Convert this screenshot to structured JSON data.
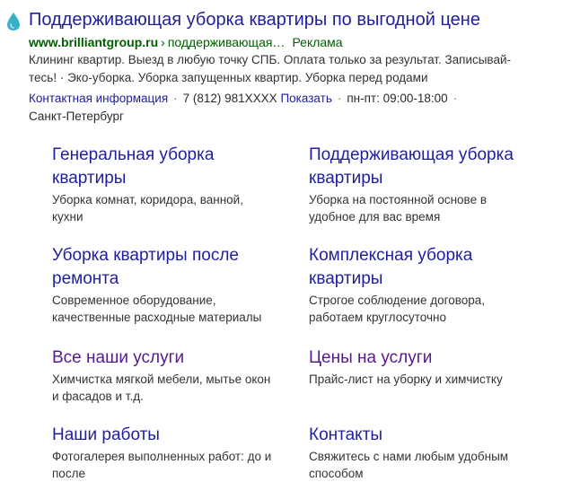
{
  "ad": {
    "title": "Поддерживающая уборка квартиры по выгодной цене",
    "url_domain": "www.brilliantgroup.ru",
    "url_separator": "›",
    "url_path": "поддерживающая…",
    "ad_label": "Реклама",
    "description_line1": "Клининг квартир. Выезд в любую точку СПБ. Оплата только за результат. Записывай-",
    "description_line2": "тесь! · Эко-уборка. Уборка запущенных квартир. Уборка перед родами",
    "contacts": {
      "info_link": "Контактная информация",
      "phone": "7 (812) 981XXXX",
      "show_label": "Показать",
      "hours": "пн-пт: 09:00-18:00",
      "city": "Санкт-Петербург"
    }
  },
  "sitelinks": [
    {
      "title_line1": "Генеральная уборка",
      "title_line2": "квартиры",
      "desc_line1": "Уборка комнат, коридора, ванной,",
      "desc_line2": "кухни"
    },
    {
      "title_line1": "Поддерживающая уборка",
      "title_line2": "квартиры",
      "desc_line1": "Уборка на постоянной основе в",
      "desc_line2": "удобное для вас время"
    },
    {
      "title_line1": "Уборка квартиры после",
      "title_line2": "ремонта",
      "desc_line1": "Современное оборудование,",
      "desc_line2": "качественные расходные материалы"
    },
    {
      "title_line1": "Комплексная уборка",
      "title_line2": "квартиры",
      "desc_line1": "Строгое соблюдение договора,",
      "desc_line2": "работаем круглосуточно"
    },
    {
      "title_line1": "Все наши услуги",
      "desc_line1": "Химчистка мягкой мебели, мытье окон",
      "desc_line2": "и фасадов и т.д."
    },
    {
      "title_line1": "Цены на услуги",
      "desc_line1": "Прайс-лист на уборку и химчистку"
    },
    {
      "title_line1": "Наши работы",
      "desc_line1": "Фотогалерея выполненных работ: до и",
      "desc_line2": "после"
    },
    {
      "title_line1": "Контакты",
      "desc_line1": "Свяжитесь с нами любым удобным",
      "desc_line2": "способом"
    }
  ],
  "colors": {
    "link": "#1f1f9e",
    "visited_link": "#551a8b",
    "url_green": "#006000",
    "text": "#333333",
    "favicon": "#3ab0c8"
  },
  "icons": {
    "favicon": "water-drop-icon"
  }
}
